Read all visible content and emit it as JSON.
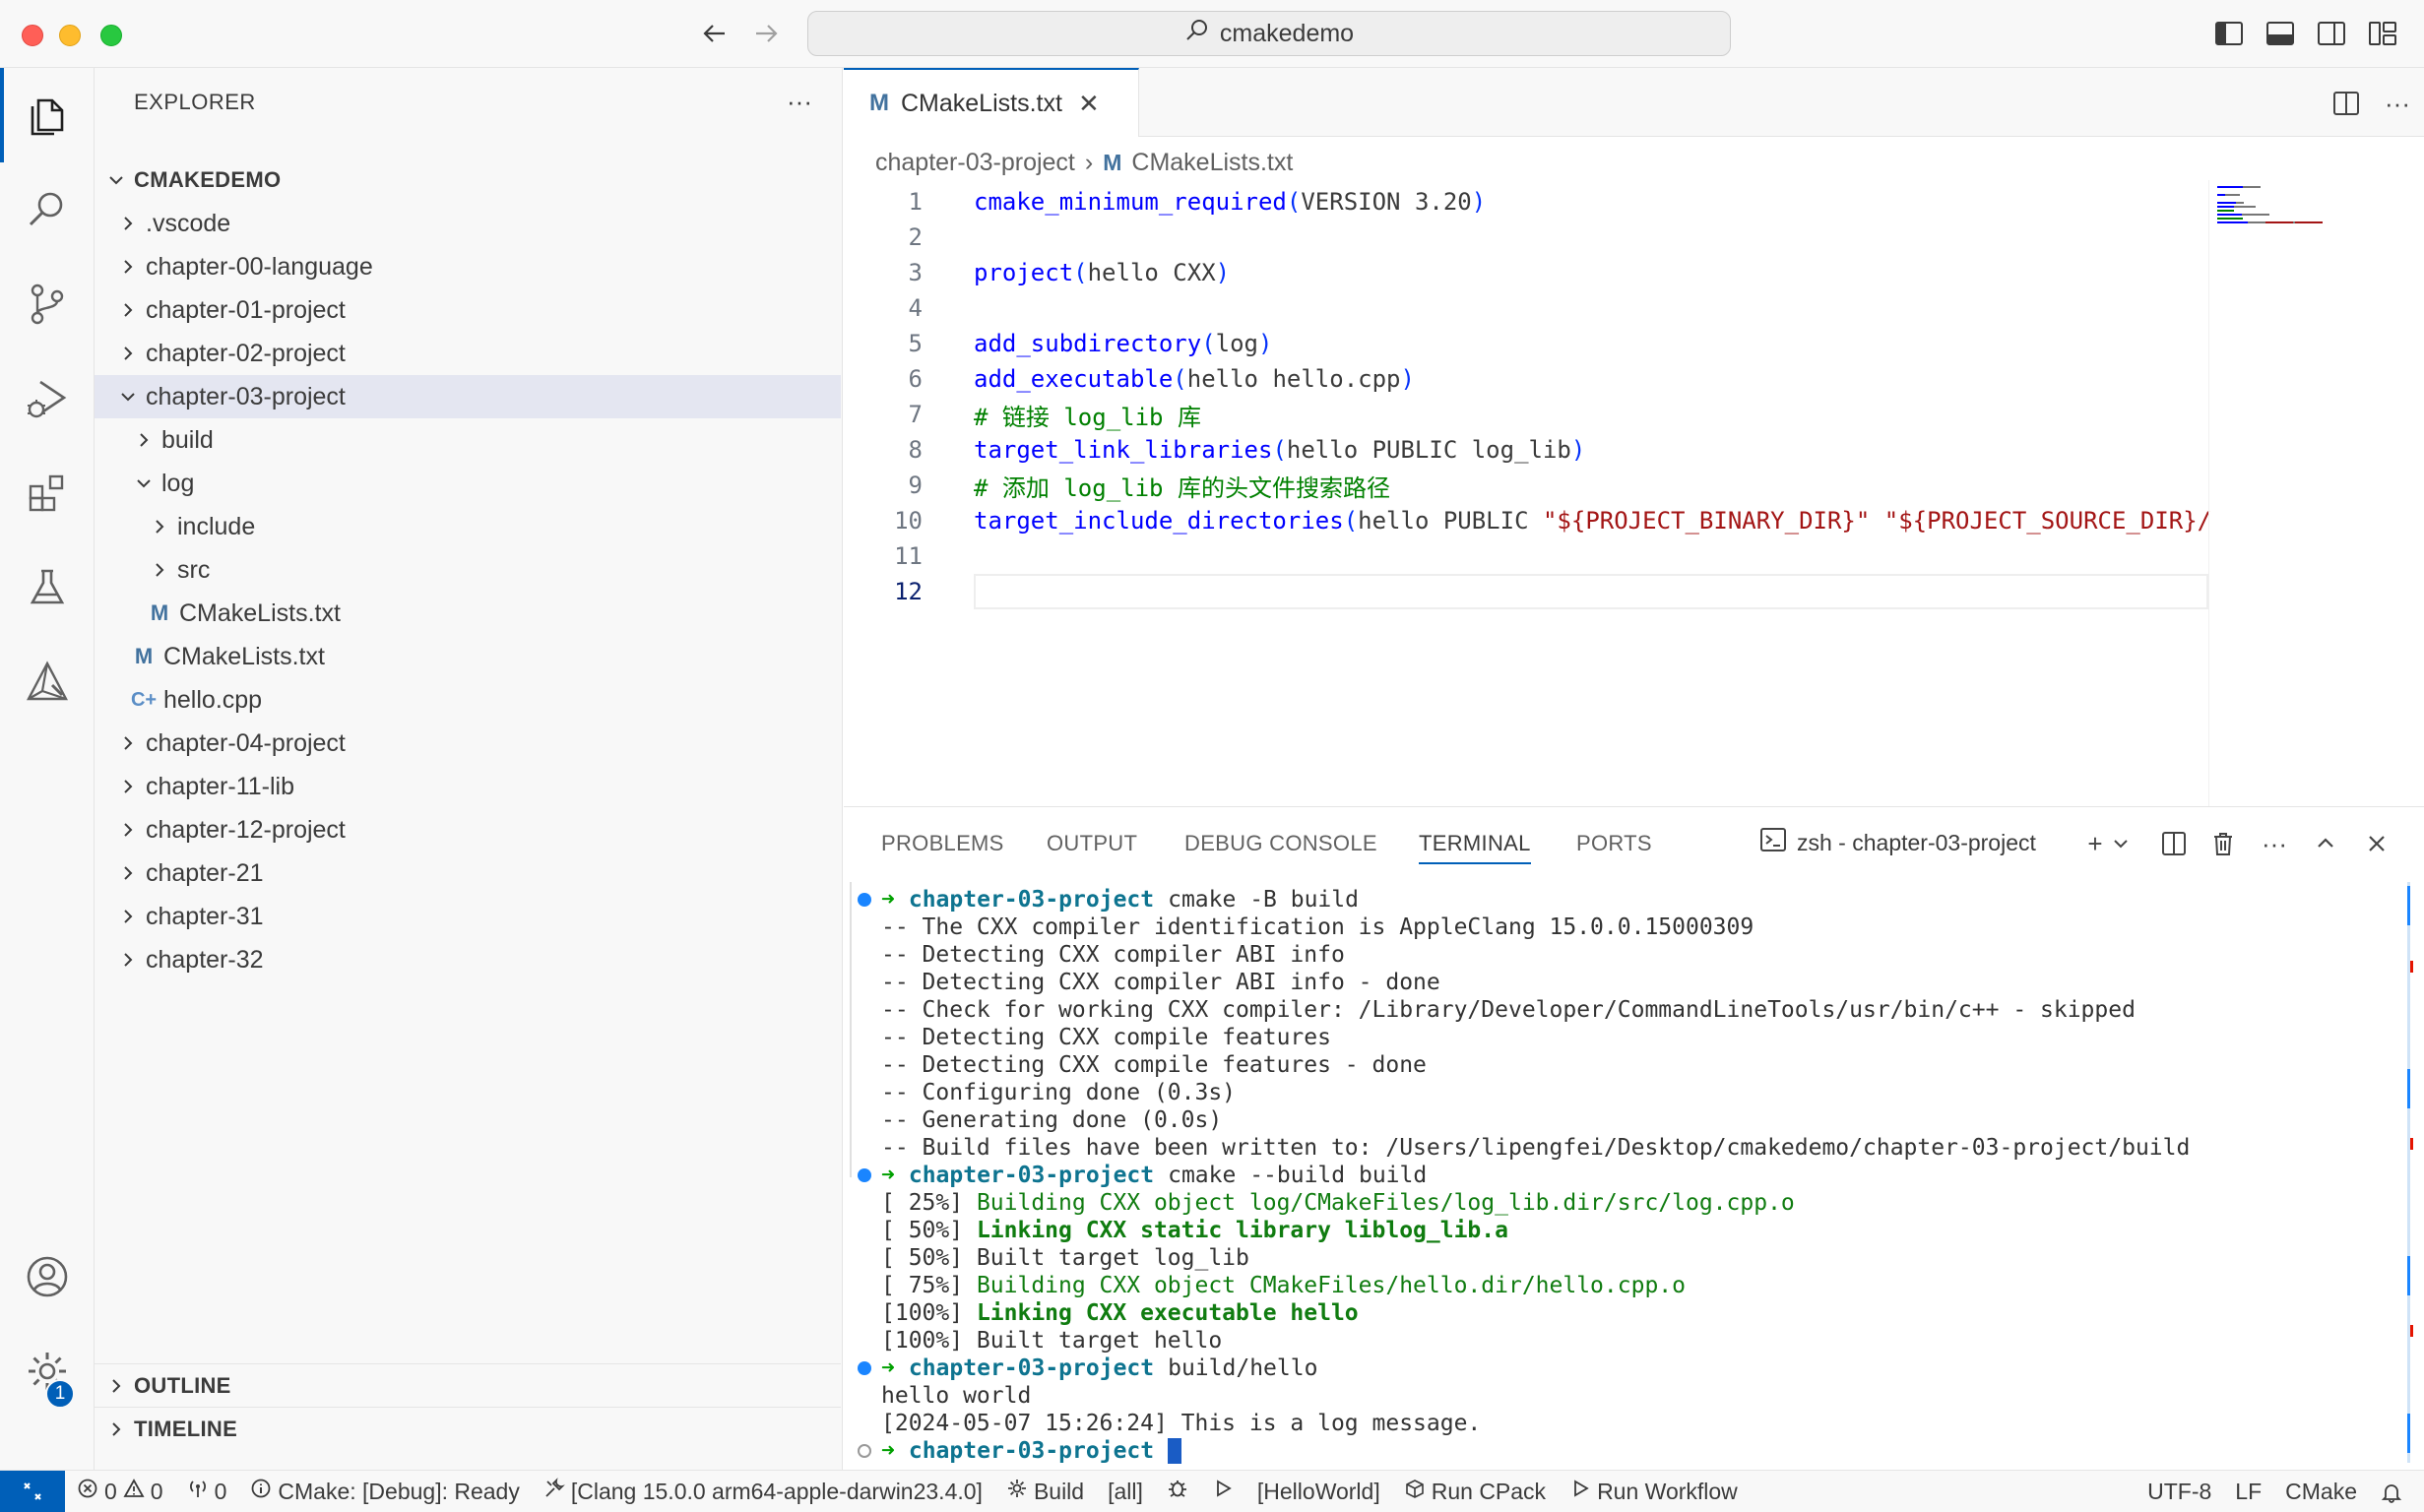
{
  "window": {
    "search_text": "cmakedemo"
  },
  "colors": {
    "accent": "#005fb8",
    "selection": "#e4e6f1",
    "keyword": "#0000ff",
    "comment": "#008000",
    "string": "#a31515",
    "terminal_green": "#107c10",
    "prompt_dir": "#0e7490"
  },
  "activity_bar": {
    "items": [
      "files-icon",
      "search-icon",
      "source-control-icon",
      "run-debug-icon",
      "extensions-icon",
      "testing-icon",
      "cmake-icon"
    ],
    "bottom": [
      "account-icon",
      "settings-gear-icon"
    ],
    "settings_badge": "1"
  },
  "sidebar": {
    "title": "EXPLORER",
    "more": "···",
    "root": "CMAKEDEMO",
    "tree": [
      {
        "label": ".vscode",
        "type": "folder",
        "expanded": false,
        "depth": 1
      },
      {
        "label": "chapter-00-language",
        "type": "folder",
        "expanded": false,
        "depth": 1
      },
      {
        "label": "chapter-01-project",
        "type": "folder",
        "expanded": false,
        "depth": 1
      },
      {
        "label": "chapter-02-project",
        "type": "folder",
        "expanded": false,
        "depth": 1
      },
      {
        "label": "chapter-03-project",
        "type": "folder",
        "expanded": true,
        "depth": 1,
        "selected": true
      },
      {
        "label": "build",
        "type": "folder",
        "expanded": false,
        "depth": 2
      },
      {
        "label": "log",
        "type": "folder",
        "expanded": true,
        "depth": 2
      },
      {
        "label": "include",
        "type": "folder",
        "expanded": false,
        "depth": 3
      },
      {
        "label": "src",
        "type": "folder",
        "expanded": false,
        "depth": 3
      },
      {
        "label": "CMakeLists.txt",
        "type": "cmake",
        "depth": 3
      },
      {
        "label": "CMakeLists.txt",
        "type": "cmake",
        "depth": 2
      },
      {
        "label": "hello.cpp",
        "type": "cpp",
        "depth": 2
      },
      {
        "label": "chapter-04-project",
        "type": "folder",
        "expanded": false,
        "depth": 1
      },
      {
        "label": "chapter-11-lib",
        "type": "folder",
        "expanded": false,
        "depth": 1
      },
      {
        "label": "chapter-12-project",
        "type": "folder",
        "expanded": false,
        "depth": 1
      },
      {
        "label": "chapter-21",
        "type": "folder",
        "expanded": false,
        "depth": 1
      },
      {
        "label": "chapter-31",
        "type": "folder",
        "expanded": false,
        "depth": 1
      },
      {
        "label": "chapter-32",
        "type": "folder",
        "expanded": false,
        "depth": 1
      }
    ],
    "outline": "OUTLINE",
    "timeline": "TIMELINE"
  },
  "editor": {
    "tab": {
      "icon": "M",
      "label": "CMakeLists.txt",
      "close": "✕"
    },
    "breadcrumb": {
      "folder": "chapter-03-project",
      "sep": "›",
      "icon": "M",
      "file": "CMakeLists.txt"
    },
    "current_line": 12,
    "lines": [
      {
        "n": "1",
        "tokens": [
          {
            "c": "kw",
            "t": "cmake_minimum_required"
          },
          {
            "c": "punct",
            "t": "("
          },
          {
            "c": "txt",
            "t": "VERSION 3.20"
          },
          {
            "c": "punct",
            "t": ")"
          }
        ]
      },
      {
        "n": "2",
        "tokens": []
      },
      {
        "n": "3",
        "tokens": [
          {
            "c": "kw",
            "t": "project"
          },
          {
            "c": "punct",
            "t": "("
          },
          {
            "c": "txt",
            "t": "hello CXX"
          },
          {
            "c": "punct",
            "t": ")"
          }
        ]
      },
      {
        "n": "4",
        "tokens": []
      },
      {
        "n": "5",
        "tokens": [
          {
            "c": "kw",
            "t": "add_subdirectory"
          },
          {
            "c": "punct",
            "t": "("
          },
          {
            "c": "txt",
            "t": "log"
          },
          {
            "c": "punct",
            "t": ")"
          }
        ]
      },
      {
        "n": "6",
        "tokens": [
          {
            "c": "kw",
            "t": "add_executable"
          },
          {
            "c": "punct",
            "t": "("
          },
          {
            "c": "txt",
            "t": "hello hello.cpp"
          },
          {
            "c": "punct",
            "t": ")"
          }
        ]
      },
      {
        "n": "7",
        "tokens": [
          {
            "c": "cm",
            "t": "# 链接 log_lib 库"
          }
        ]
      },
      {
        "n": "8",
        "tokens": [
          {
            "c": "kw",
            "t": "target_link_libraries"
          },
          {
            "c": "punct",
            "t": "("
          },
          {
            "c": "txt",
            "t": "hello PUBLIC log_lib"
          },
          {
            "c": "punct",
            "t": ")"
          }
        ]
      },
      {
        "n": "9",
        "tokens": [
          {
            "c": "cm",
            "t": "# 添加 log_lib 库的头文件搜索路径"
          }
        ]
      },
      {
        "n": "10",
        "tokens": [
          {
            "c": "kw",
            "t": "target_include_directories"
          },
          {
            "c": "punct",
            "t": "("
          },
          {
            "c": "txt",
            "t": "hello PUBLIC "
          },
          {
            "c": "str",
            "t": "\"${PROJECT_BINARY_DIR}\""
          },
          {
            "c": "txt",
            "t": " "
          },
          {
            "c": "str",
            "t": "\"${PROJECT_SOURCE_DIR}/"
          }
        ]
      },
      {
        "n": "11",
        "tokens": []
      },
      {
        "n": "12",
        "tokens": []
      }
    ]
  },
  "panel": {
    "tabs": [
      "PROBLEMS",
      "OUTPUT",
      "DEBUG CONSOLE",
      "TERMINAL",
      "PORTS"
    ],
    "active_tab": "TERMINAL",
    "terminal_name": "zsh - chapter-03-project",
    "add": "+",
    "more": "···",
    "terminal_lines": [
      {
        "dot": "blue",
        "tokens": [
          {
            "c": "arrow",
            "t": "➜"
          },
          {
            "c": "dir",
            "t": "chapter-03-project"
          },
          {
            "c": "plain",
            "t": "cmake -B build"
          }
        ]
      },
      {
        "tokens": [
          {
            "c": "plain",
            "t": "-- The CXX compiler identification is AppleClang 15.0.0.15000309"
          }
        ]
      },
      {
        "tokens": [
          {
            "c": "plain",
            "t": "-- Detecting CXX compiler ABI info"
          }
        ]
      },
      {
        "tokens": [
          {
            "c": "plain",
            "t": "-- Detecting CXX compiler ABI info - done"
          }
        ]
      },
      {
        "tokens": [
          {
            "c": "plain",
            "t": "-- Check for working CXX compiler: /Library/Developer/CommandLineTools/usr/bin/c++ - skipped"
          }
        ]
      },
      {
        "tokens": [
          {
            "c": "plain",
            "t": "-- Detecting CXX compile features"
          }
        ]
      },
      {
        "tokens": [
          {
            "c": "plain",
            "t": "-- Detecting CXX compile features - done"
          }
        ]
      },
      {
        "tokens": [
          {
            "c": "plain",
            "t": "-- Configuring done (0.3s)"
          }
        ]
      },
      {
        "tokens": [
          {
            "c": "plain",
            "t": "-- Generating done (0.0s)"
          }
        ]
      },
      {
        "tokens": [
          {
            "c": "plain",
            "t": "-- Build files have been written to: /Users/lipengfei/Desktop/cmakedemo/chapter-03-project/build"
          }
        ]
      },
      {
        "dot": "blue",
        "tokens": [
          {
            "c": "arrow",
            "t": "➜"
          },
          {
            "c": "dir",
            "t": "chapter-03-project"
          },
          {
            "c": "plain",
            "t": "cmake --build build"
          }
        ]
      },
      {
        "tokens": [
          {
            "c": "plain",
            "t": "[ 25%] "
          },
          {
            "c": "green",
            "t": "Building CXX object log/CMakeFiles/log_lib.dir/src/log.cpp.o"
          }
        ]
      },
      {
        "tokens": [
          {
            "c": "plain",
            "t": "[ 50%] "
          },
          {
            "c": "greenb",
            "t": "Linking CXX static library liblog_lib.a"
          }
        ]
      },
      {
        "tokens": [
          {
            "c": "plain",
            "t": "[ 50%] Built target log_lib"
          }
        ]
      },
      {
        "tokens": [
          {
            "c": "plain",
            "t": "[ 75%] "
          },
          {
            "c": "green",
            "t": "Building CXX object CMakeFiles/hello.dir/hello.cpp.o"
          }
        ]
      },
      {
        "tokens": [
          {
            "c": "plain",
            "t": "[100%] "
          },
          {
            "c": "greenb",
            "t": "Linking CXX executable hello"
          }
        ]
      },
      {
        "tokens": [
          {
            "c": "plain",
            "t": "[100%] Built target hello"
          }
        ]
      },
      {
        "dot": "blue",
        "tokens": [
          {
            "c": "arrow",
            "t": "➜"
          },
          {
            "c": "dir",
            "t": "chapter-03-project"
          },
          {
            "c": "plain",
            "t": "build/hello"
          }
        ]
      },
      {
        "tokens": [
          {
            "c": "plain",
            "t": "hello world"
          }
        ]
      },
      {
        "tokens": [
          {
            "c": "plain",
            "t": "[2024-05-07 15:26:24] This is a log message."
          }
        ]
      },
      {
        "dot": "hollow",
        "tokens": [
          {
            "c": "arrow",
            "t": "➜"
          },
          {
            "c": "dir",
            "t": "chapter-03-project"
          },
          {
            "c": "cursor",
            "t": ""
          }
        ]
      }
    ]
  },
  "statusbar": {
    "errors": "0",
    "warnings": "0",
    "ports": "0",
    "cmake_status": "CMake: [Debug]: Ready",
    "kit": "[Clang 15.0.0 arm64-apple-darwin23.4.0]",
    "build": "Build",
    "target": "[all]",
    "launch_target": "[HelloWorld]",
    "cpack": "Run CPack",
    "workflow": "Run Workflow",
    "encoding": "UTF-8",
    "eol": "LF",
    "language": "CMake"
  }
}
